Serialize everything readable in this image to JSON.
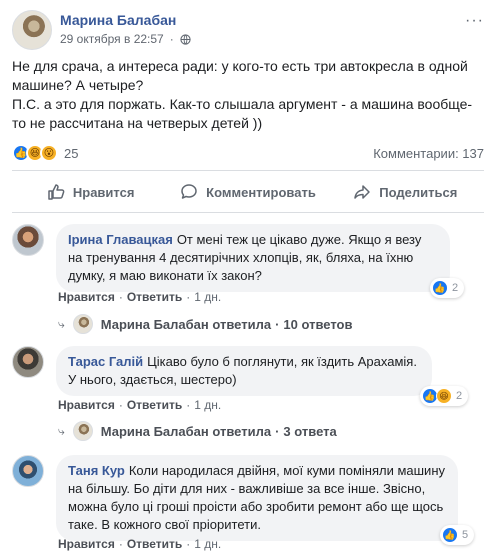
{
  "post": {
    "author": "Марина Балабан",
    "date": "29 октября в 22:57",
    "more": "···",
    "text_line1": "Не для срача, а интереса ради: у кого-то есть три автокресла в одной машине? А четыре?",
    "text_line2": "П.С. а это для поржать. Как-то слышала аргумент - а машина вообще-то не рассчитана на четверых детей ))"
  },
  "stats": {
    "reaction_icons": [
      "like",
      "haha",
      "wow"
    ],
    "reaction_count": "25",
    "comments_label": "Комментарии: 137"
  },
  "actions": {
    "like": "Нравится",
    "comment": "Комментировать",
    "share": "Поделиться"
  },
  "comments": [
    {
      "name": "Ірина Главацкая",
      "text": "От мені теж це цікаво дуже. Якщо я везу на тренування 4 десятирічних хлопців, як, бляха, на їхню думку, я маю виконати їх закон?",
      "like_label": "Нравится",
      "reply_label": "Ответить",
      "time": "1 дн.",
      "reactions": [
        "like"
      ],
      "reaction_count": "2",
      "reply_summary": {
        "replier": "Марина Балабан ответила",
        "count": "10 ответов"
      }
    },
    {
      "name": "Тарас Галій",
      "text": "Цікаво було б поглянути, як їздить Арахамія. У нього, здається, шестеро)",
      "like_label": "Нравится",
      "reply_label": "Ответить",
      "time": "1 дн.",
      "reactions": [
        "like",
        "haha"
      ],
      "reaction_count": "2",
      "reply_summary": {
        "replier": "Марина Балабан ответила",
        "count": "3 ответа"
      }
    },
    {
      "name": "Таня Кур",
      "text": "Коли народилася двійня, мої куми поміняли машину на більшу. Бо діти для них - важливіше за все інше. Звісно, можна було ці гроші проісти або зробити ремонт або ще щось таке. В кожного свої пріоритети.",
      "like_label": "Нравится",
      "reply_label": "Ответить",
      "time": "1 дн.",
      "reactions": [
        "like"
      ],
      "reaction_count": "5"
    }
  ],
  "separator": "·",
  "colors": {
    "link_blue": "#385898",
    "like_blue": "#1877f2",
    "bubble_bg": "#f2f3f5",
    "muted": "#606770"
  }
}
